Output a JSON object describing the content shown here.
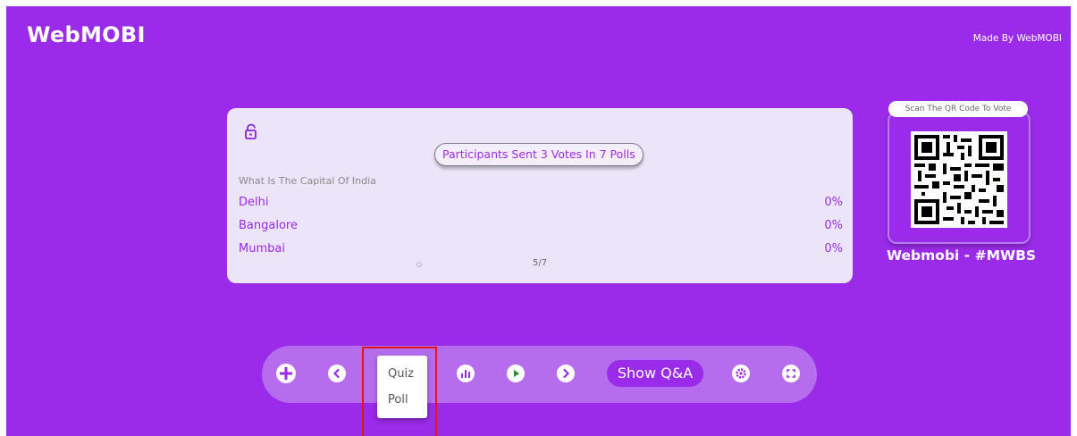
{
  "header": {
    "brand": "WebMOBI",
    "made_by": "Made By WebMOBI"
  },
  "poll": {
    "lock_icon": "lock-open-icon",
    "summary": "Participants Sent 3 Votes In 7 Polls",
    "question": "What Is The Capital Of India",
    "options": [
      {
        "label": "Delhi",
        "percent": "0%"
      },
      {
        "label": "Bangalore",
        "percent": "0%"
      },
      {
        "label": "Mumbai",
        "percent": "0%"
      }
    ],
    "page_indicator": "5/7"
  },
  "qr": {
    "label": "Scan The QR Code To Vote",
    "event_name": "Webmobi - #MWBS"
  },
  "toolbar": {
    "add_icon": "plus-icon",
    "prev_icon": "chevron-left-icon",
    "chart_icon": "bar-chart-icon",
    "play_icon": "play-icon",
    "next_icon": "chevron-right-icon",
    "qa_label": "Show Q&A",
    "settings_icon": "gear-icon",
    "fullscreen_icon": "fullscreen-icon"
  },
  "dropdown": {
    "items": [
      "Quiz",
      "Poll"
    ]
  },
  "colors": {
    "background": "#9a2be8",
    "card": "#ece4f8",
    "accent": "#9a2be8",
    "highlight": "#e31616"
  }
}
